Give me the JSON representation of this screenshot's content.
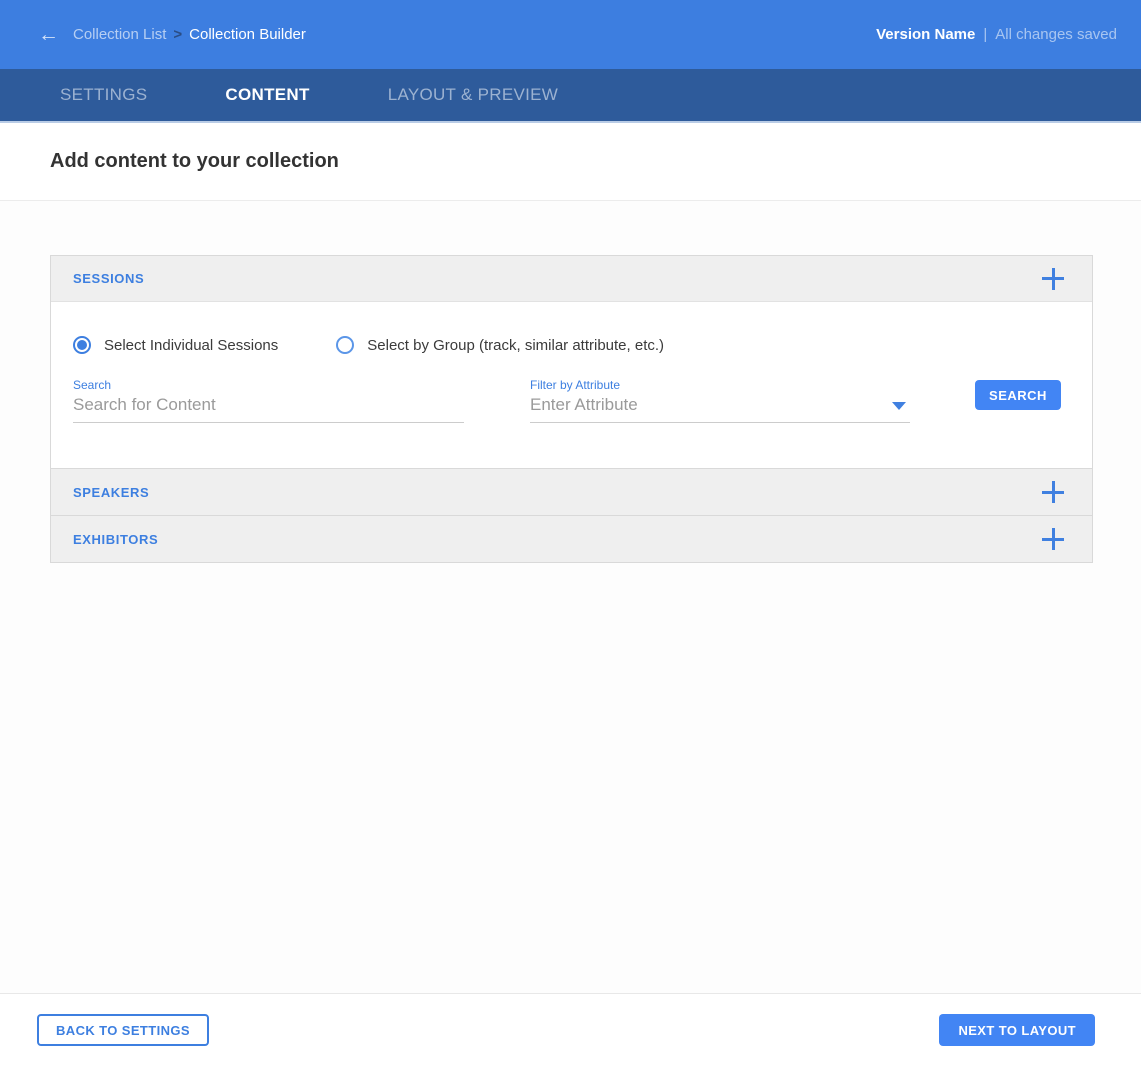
{
  "colors": {
    "appbar_bg": "#3d7ee0",
    "tabbar_bg": "#2e5b9b",
    "accent_blue": "#3d7fe0",
    "button_blue": "#4285f4",
    "panel_header_bg": "#efefef"
  },
  "header": {
    "back_icon": "arrow-left-icon",
    "breadcrumb": {
      "parent": "Collection List",
      "separator": ">",
      "current": "Collection Builder"
    },
    "version_name": "Version Name",
    "status_separator": "|",
    "save_status": "All changes saved"
  },
  "tabs": [
    {
      "label": "SETTINGS",
      "active": false
    },
    {
      "label": "CONTENT",
      "active": true
    },
    {
      "label": "LAYOUT & PREVIEW",
      "active": false
    }
  ],
  "page": {
    "title": "Add content to your collection"
  },
  "accordion": {
    "sessions": {
      "title": "SESSIONS",
      "expanded": true,
      "toggle_icon": "plus-icon",
      "radios": [
        {
          "label": "Select Individual Sessions",
          "selected": true
        },
        {
          "label": "Select by Group (track, similar attribute, etc.)",
          "selected": false
        }
      ],
      "search_field": {
        "label": "Search",
        "placeholder": "Search for Content",
        "value": ""
      },
      "filter_field": {
        "label": "Filter by Attribute",
        "placeholder": "Enter Attribute",
        "value": ""
      },
      "search_button": "SEARCH"
    },
    "speakers": {
      "title": "SPEAKERS",
      "expanded": false,
      "toggle_icon": "plus-icon"
    },
    "exhibitors": {
      "title": "EXHIBITORS",
      "expanded": false,
      "toggle_icon": "plus-icon"
    }
  },
  "footer": {
    "back_button": "BACK TO SETTINGS",
    "next_button": "NEXT TO LAYOUT"
  }
}
